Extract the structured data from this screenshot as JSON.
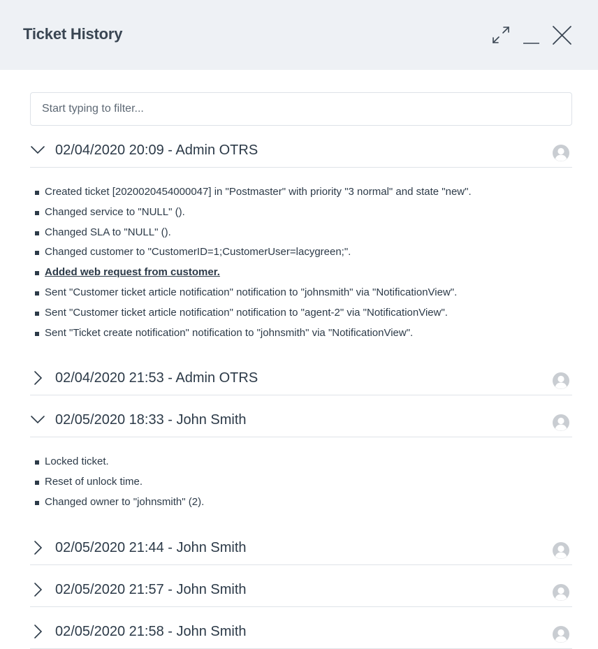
{
  "header": {
    "title": "Ticket History"
  },
  "filter": {
    "placeholder": "Start typing to filter..."
  },
  "entries": [
    {
      "label": "02/04/2020 20:09 - Admin OTRS",
      "expanded": true,
      "items": [
        {
          "text": "Created ticket [2020020454000047] in \"Postmaster\" with priority \"3 normal\" and state \"new\"."
        },
        {
          "text": "Changed service to \"NULL\" ()."
        },
        {
          "text": "Changed SLA to \"NULL\" ()."
        },
        {
          "text": "Changed customer to \"CustomerID=1;CustomerUser=lacygreen;\"."
        },
        {
          "text": "Added web request from customer.",
          "link": true
        },
        {
          "text": "Sent \"Customer ticket article notification\" notification to \"johnsmith\" via \"NotificationView\"."
        },
        {
          "text": "Sent \"Customer ticket article notification\" notification to \"agent-2\" via \"NotificationView\"."
        },
        {
          "text": "Sent \"Ticket create notification\" notification to \"johnsmith\" via \"NotificationView\"."
        }
      ]
    },
    {
      "label": "02/04/2020 21:53 - Admin OTRS",
      "expanded": false,
      "items": []
    },
    {
      "label": "02/05/2020 18:33 - John Smith",
      "expanded": true,
      "items": [
        {
          "text": "Locked ticket."
        },
        {
          "text": "Reset of unlock time."
        },
        {
          "text": "Changed owner to \"johnsmith\" (2)."
        }
      ]
    },
    {
      "label": "02/05/2020 21:44 - John Smith",
      "expanded": false,
      "items": []
    },
    {
      "label": "02/05/2020 21:57 - John Smith",
      "expanded": false,
      "items": []
    },
    {
      "label": "02/05/2020 21:58 - John Smith",
      "expanded": false,
      "items": []
    }
  ],
  "colors": {
    "header_bg": "#eef1f5",
    "text": "#2c3a48",
    "divider": "#dfe3e8",
    "avatar": "#c9cdd2"
  },
  "icons": {
    "expand": "expand-arrows-icon",
    "minimize": "minimize-icon",
    "close": "close-icon",
    "collapsed": "chevron-right-icon",
    "expanded": "chevron-down-icon",
    "avatar": "user-avatar-icon"
  }
}
